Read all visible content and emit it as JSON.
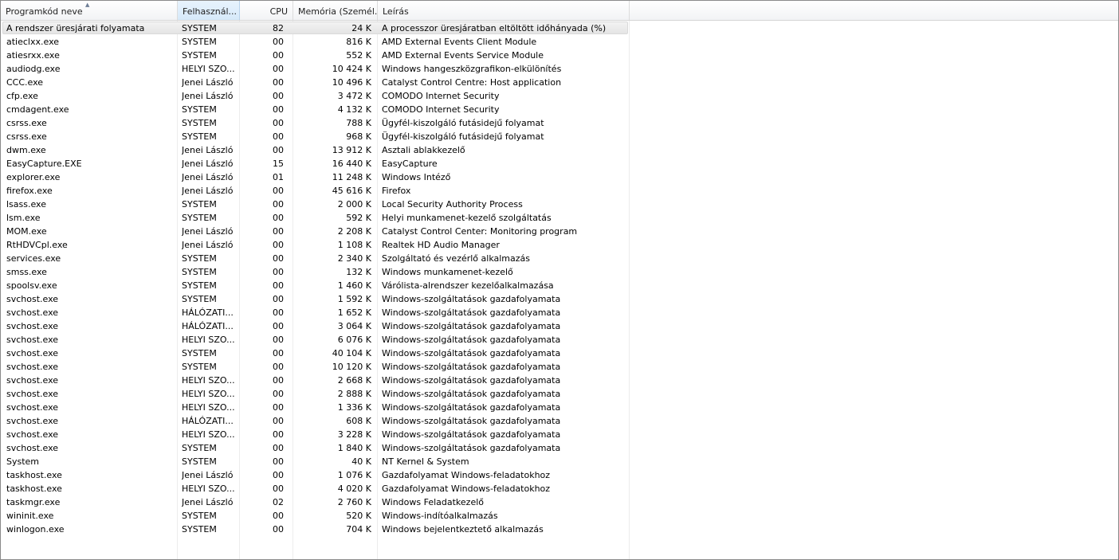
{
  "columns": {
    "name": "Programkód neve",
    "user": "Felhasznál...",
    "cpu": "CPU",
    "memory": "Memória (Személ...",
    "description": "Leírás"
  },
  "processes": [
    {
      "name": "A rendszer üresjárati folyamata",
      "user": "SYSTEM",
      "cpu": "82",
      "memory": "24 K",
      "description": "A processzor üresjáratban eltöltött időhányada (%)"
    },
    {
      "name": "atieclxx.exe",
      "user": "SYSTEM",
      "cpu": "00",
      "memory": "816 K",
      "description": "AMD External Events Client Module"
    },
    {
      "name": "atiesrxx.exe",
      "user": "SYSTEM",
      "cpu": "00",
      "memory": "552 K",
      "description": "AMD External Events Service Module"
    },
    {
      "name": "audiodg.exe",
      "user": "HELYI SZO...",
      "cpu": "00",
      "memory": "10 424 K",
      "description": "Windows hangeszközgrafikon-elkülönítés"
    },
    {
      "name": "CCC.exe",
      "user": "Jenei László",
      "cpu": "00",
      "memory": "10 496 K",
      "description": "Catalyst Control Centre: Host application"
    },
    {
      "name": "cfp.exe",
      "user": "Jenei László",
      "cpu": "00",
      "memory": "3 472 K",
      "description": "COMODO Internet Security"
    },
    {
      "name": "cmdagent.exe",
      "user": "SYSTEM",
      "cpu": "00",
      "memory": "4 132 K",
      "description": "COMODO Internet Security"
    },
    {
      "name": "csrss.exe",
      "user": "SYSTEM",
      "cpu": "00",
      "memory": "788 K",
      "description": "Ügyfél-kiszolgáló futásidejű folyamat"
    },
    {
      "name": "csrss.exe",
      "user": "SYSTEM",
      "cpu": "00",
      "memory": "968 K",
      "description": "Ügyfél-kiszolgáló futásidejű folyamat"
    },
    {
      "name": "dwm.exe",
      "user": "Jenei László",
      "cpu": "00",
      "memory": "13 912 K",
      "description": "Asztali ablakkezelő"
    },
    {
      "name": "EasyCapture.EXE",
      "user": "Jenei László",
      "cpu": "15",
      "memory": "16 440 K",
      "description": "EasyCapture"
    },
    {
      "name": "explorer.exe",
      "user": "Jenei László",
      "cpu": "01",
      "memory": "11 248 K",
      "description": "Windows Intéző"
    },
    {
      "name": "firefox.exe",
      "user": "Jenei László",
      "cpu": "00",
      "memory": "45 616 K",
      "description": "Firefox"
    },
    {
      "name": "lsass.exe",
      "user": "SYSTEM",
      "cpu": "00",
      "memory": "2 000 K",
      "description": "Local Security Authority Process"
    },
    {
      "name": "lsm.exe",
      "user": "SYSTEM",
      "cpu": "00",
      "memory": "592 K",
      "description": "Helyi munkamenet-kezelő szolgáltatás"
    },
    {
      "name": "MOM.exe",
      "user": "Jenei László",
      "cpu": "00",
      "memory": "2 208 K",
      "description": "Catalyst Control Center: Monitoring program"
    },
    {
      "name": "RtHDVCpl.exe",
      "user": "Jenei László",
      "cpu": "00",
      "memory": "1 108 K",
      "description": "Realtek HD Audio Manager"
    },
    {
      "name": "services.exe",
      "user": "SYSTEM",
      "cpu": "00",
      "memory": "2 340 K",
      "description": "Szolgáltató és vezérlő alkalmazás"
    },
    {
      "name": "smss.exe",
      "user": "SYSTEM",
      "cpu": "00",
      "memory": "132 K",
      "description": "Windows munkamenet-kezelő"
    },
    {
      "name": "spoolsv.exe",
      "user": "SYSTEM",
      "cpu": "00",
      "memory": "1 460 K",
      "description": "Várólista-alrendszer kezelőalkalmazása"
    },
    {
      "name": "svchost.exe",
      "user": "SYSTEM",
      "cpu": "00",
      "memory": "1 592 K",
      "description": "Windows-szolgáltatások gazdafolyamata"
    },
    {
      "name": "svchost.exe",
      "user": "HÁLÓZATI...",
      "cpu": "00",
      "memory": "1 652 K",
      "description": "Windows-szolgáltatások gazdafolyamata"
    },
    {
      "name": "svchost.exe",
      "user": "HÁLÓZATI...",
      "cpu": "00",
      "memory": "3 064 K",
      "description": "Windows-szolgáltatások gazdafolyamata"
    },
    {
      "name": "svchost.exe",
      "user": "HELYI SZO...",
      "cpu": "00",
      "memory": "6 076 K",
      "description": "Windows-szolgáltatások gazdafolyamata"
    },
    {
      "name": "svchost.exe",
      "user": "SYSTEM",
      "cpu": "00",
      "memory": "40 104 K",
      "description": "Windows-szolgáltatások gazdafolyamata"
    },
    {
      "name": "svchost.exe",
      "user": "SYSTEM",
      "cpu": "00",
      "memory": "10 120 K",
      "description": "Windows-szolgáltatások gazdafolyamata"
    },
    {
      "name": "svchost.exe",
      "user": "HELYI SZO...",
      "cpu": "00",
      "memory": "2 668 K",
      "description": "Windows-szolgáltatások gazdafolyamata"
    },
    {
      "name": "svchost.exe",
      "user": "HELYI SZO...",
      "cpu": "00",
      "memory": "2 888 K",
      "description": "Windows-szolgáltatások gazdafolyamata"
    },
    {
      "name": "svchost.exe",
      "user": "HELYI SZO...",
      "cpu": "00",
      "memory": "1 336 K",
      "description": "Windows-szolgáltatások gazdafolyamata"
    },
    {
      "name": "svchost.exe",
      "user": "HÁLÓZATI...",
      "cpu": "00",
      "memory": "608 K",
      "description": "Windows-szolgáltatások gazdafolyamata"
    },
    {
      "name": "svchost.exe",
      "user": "HELYI SZO...",
      "cpu": "00",
      "memory": "3 228 K",
      "description": "Windows-szolgáltatások gazdafolyamata"
    },
    {
      "name": "svchost.exe",
      "user": "SYSTEM",
      "cpu": "00",
      "memory": "1 840 K",
      "description": "Windows-szolgáltatások gazdafolyamata"
    },
    {
      "name": "System",
      "user": "SYSTEM",
      "cpu": "00",
      "memory": "40 K",
      "description": "NT Kernel & System"
    },
    {
      "name": "taskhost.exe",
      "user": "Jenei László",
      "cpu": "00",
      "memory": "1 076 K",
      "description": "Gazdafolyamat Windows-feladatokhoz"
    },
    {
      "name": "taskhost.exe",
      "user": "HELYI SZO...",
      "cpu": "00",
      "memory": "4 020 K",
      "description": "Gazdafolyamat Windows-feladatokhoz"
    },
    {
      "name": "taskmgr.exe",
      "user": "Jenei László",
      "cpu": "02",
      "memory": "2 760 K",
      "description": "Windows Feladatkezelő"
    },
    {
      "name": "wininit.exe",
      "user": "SYSTEM",
      "cpu": "00",
      "memory": "520 K",
      "description": "Windows-indítóalkalmazás"
    },
    {
      "name": "winlogon.exe",
      "user": "SYSTEM",
      "cpu": "00",
      "memory": "704 K",
      "description": "Windows bejelentkeztető alkalmazás"
    }
  ]
}
